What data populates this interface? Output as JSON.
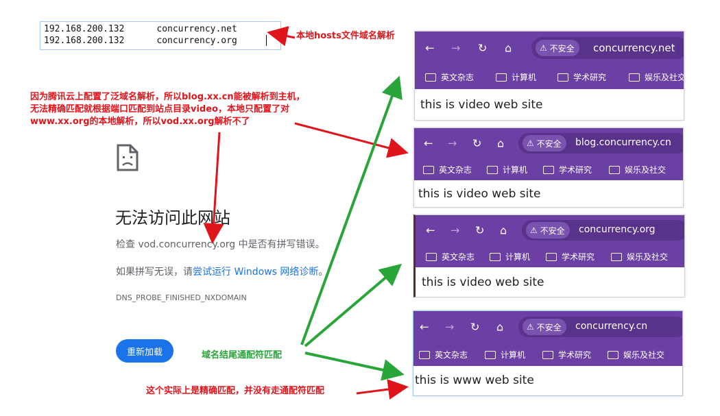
{
  "hosts": {
    "lines": [
      {
        "ip": "192.168.200.132",
        "domain": "concurrency.net"
      },
      {
        "ip": "192.168.200.132",
        "domain": "concurrency.org"
      }
    ],
    "label": "本地hosts文件域名解析"
  },
  "annotations": {
    "explain_line1": "因为腾讯云上配置了泛域名解析，所以blog.xx.cn能被解析到主机，",
    "explain_line2": "无法精确匹配就根据端口匹配到站点目录video，本地只配置了对",
    "explain_line3": "www.xx.org的本地解析，所以vod.xx.org解析不了",
    "wildcard_label": "域名结尾通配符匹配",
    "exact_label": "这个实际上是精确匹配，并没有走通配符匹配"
  },
  "error_page": {
    "title": "无法访问此网站",
    "check_prefix": "检查 vod.concurrency.org 中是否有拼写错误。",
    "retry_prefix": "如果拼写无误，请",
    "retry_link": "尝试运行 Windows 网络诊断",
    "retry_suffix": "。",
    "error_code": "DNS_PROBE_FINISHED_NXDOMAIN",
    "reload_label": "重新加载"
  },
  "browsers": [
    {
      "security": "不安全",
      "url": "concurrency.net",
      "content": "this is video web site"
    },
    {
      "security": "不安全",
      "url": "blog.concurrency.cn",
      "content": "this is video web site"
    },
    {
      "security": "不安全",
      "url": "concurrency.org",
      "content": "this is video web site"
    },
    {
      "security": "不安全",
      "url": "concurrency.cn",
      "content": "this is www web site"
    }
  ],
  "bookmarks": [
    "英文杂志",
    "计算机",
    "学术研究",
    "娱乐及社交"
  ],
  "icons": {
    "back": "back-arrow-icon",
    "forward": "forward-arrow-icon",
    "reload": "reload-icon",
    "home": "home-icon",
    "warning": "warning-triangle-icon",
    "folder": "folder-icon",
    "sad_page": "sad-document-icon"
  },
  "colors": {
    "browser_purple": "#6b3fa3",
    "annotation_red": "#e0141b",
    "annotation_green": "#2aa53a",
    "link_blue": "#1a73e8"
  }
}
